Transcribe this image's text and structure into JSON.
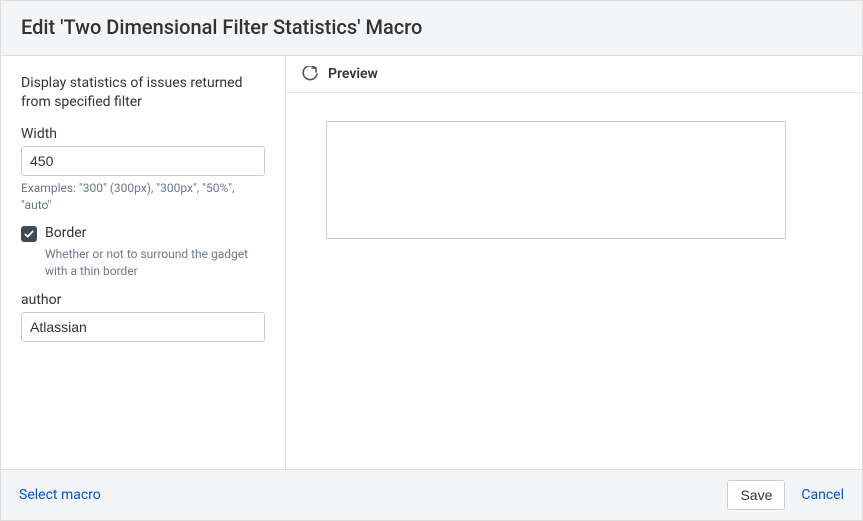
{
  "header": {
    "title": "Edit 'Two Dimensional Filter Statistics' Macro"
  },
  "sidebar": {
    "description": "Display statistics of issues returned from specified filter",
    "width": {
      "label": "Width",
      "value": "450",
      "hint": "Examples: \"300\" (300px), \"300px\", \"50%\", \"auto\""
    },
    "border": {
      "label": "Border",
      "checked": true,
      "hint": "Whether or not to surround the gadget with a thin border"
    },
    "author": {
      "label": "author",
      "value": "Atlassian"
    }
  },
  "preview": {
    "title": "Preview"
  },
  "footer": {
    "select_macro": "Select macro",
    "save": "Save",
    "cancel": "Cancel"
  }
}
